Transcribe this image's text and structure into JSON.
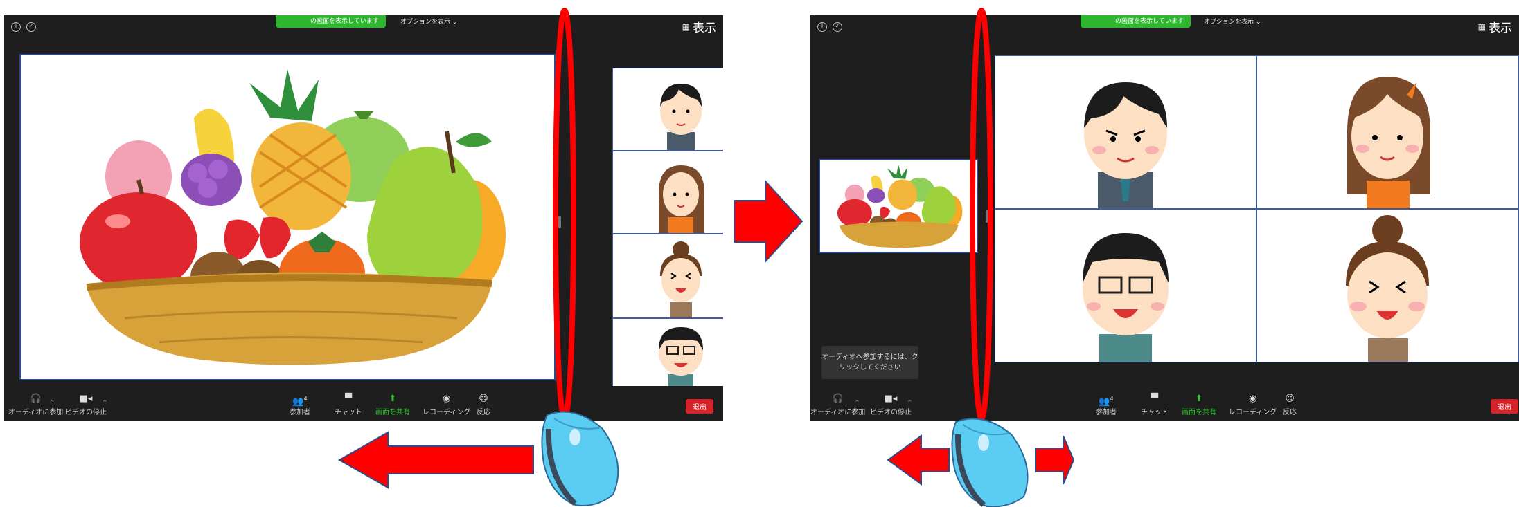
{
  "left_panel": {
    "banner": "の画面を表示しています",
    "options": "オプションを表示 ⌄",
    "view": "表示",
    "toolbar": {
      "audio": "オーディオに参加",
      "video": "ビデオの停止",
      "participants": "参加者",
      "participant_count": "4",
      "chat": "チャット",
      "share": "画面を共有",
      "record": "レコーディング",
      "reactions": "反応",
      "leave": "退出"
    }
  },
  "right_panel": {
    "banner": "の画面を表示しています",
    "options": "オプションを表示 ⌄",
    "view": "表示",
    "tooltip": "オーディオへ参加するには、クリックしてください",
    "toolbar": {
      "audio": "オーディオに参加",
      "video": "ビデオの停止",
      "participants": "参加者",
      "participant_count": "4",
      "chat": "チャット",
      "share": "画面を共有",
      "record": "レコーディング",
      "reactions": "反応",
      "leave": "退出"
    }
  },
  "colors": {
    "app_bg": "#1e1e1e",
    "share_green": "#2fb62f",
    "leave_red": "#d2232a",
    "annotation_red": "#ff0000",
    "mouse_blue": "#5ccdf2"
  },
  "icons": {
    "info": "info-icon",
    "shield": "shield-icon",
    "grid": "grid-view-icon",
    "headphones": "headphones-icon",
    "camera": "video-camera-icon",
    "people": "participants-icon",
    "chat": "chat-bubble-icon",
    "share": "share-screen-icon",
    "record": "record-icon",
    "reaction": "reaction-icon",
    "mouse": "mouse-icon"
  }
}
